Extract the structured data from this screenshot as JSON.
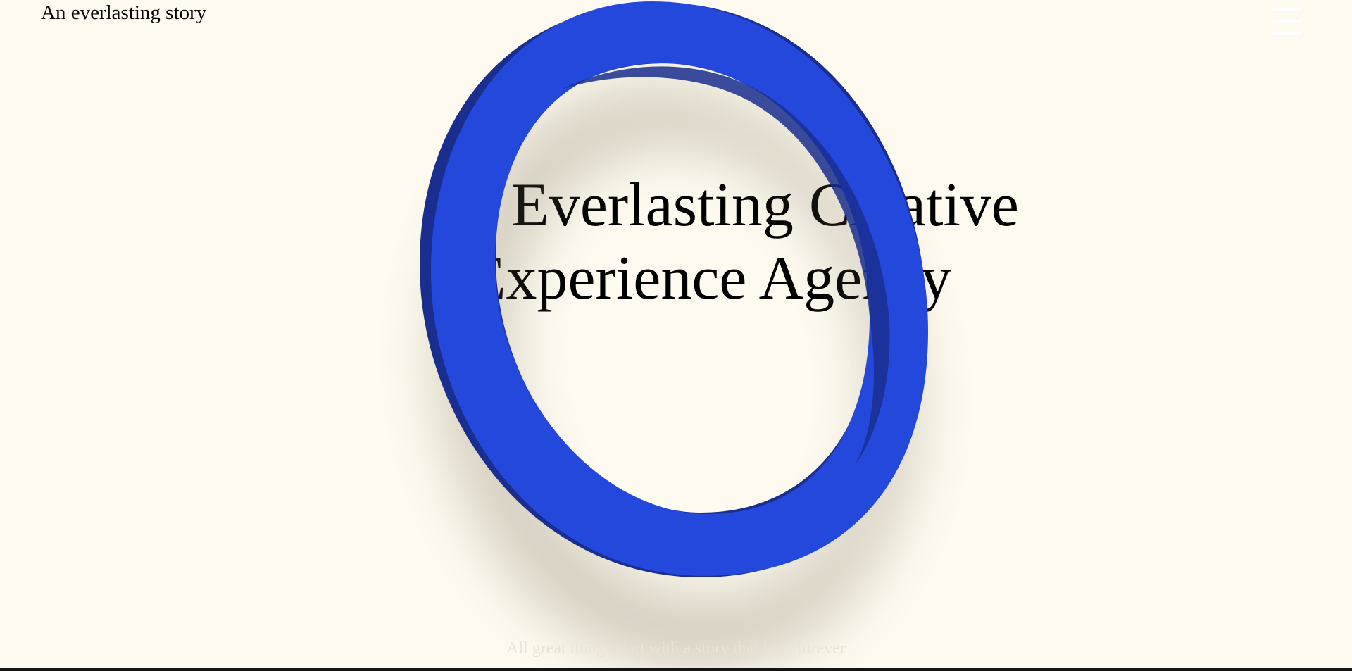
{
  "header": {
    "brand": "An everlasting story",
    "menu_icon": "hamburger-menu-icon"
  },
  "hero": {
    "title_line1": "e Everlasting Creative",
    "title_line2": "Experience Agency",
    "ring_icon": "blue-ring-graphic"
  },
  "footer": {
    "tagline": "All great things start with a story that lasts forever"
  },
  "colors": {
    "background": "#fefaef",
    "ring_blue": "#2447dc",
    "ring_shade": "#1a2e8f",
    "text": "#000000"
  }
}
